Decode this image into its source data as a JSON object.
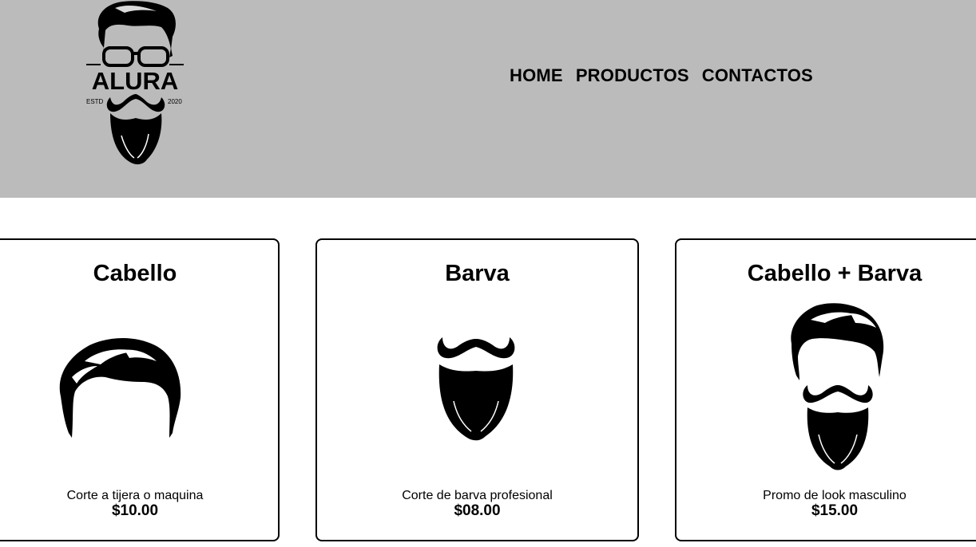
{
  "header": {
    "logo": {
      "brand": "ALURA",
      "estd_label": "ESTD",
      "year": "2020"
    },
    "nav": [
      {
        "label": "HOME"
      },
      {
        "label": "PRODUCTOS"
      },
      {
        "label": "CONTACTOS"
      }
    ]
  },
  "products": [
    {
      "title": "Cabello",
      "icon": "hair-icon",
      "description": "Corte a tijera o maquina",
      "price": "$10.00"
    },
    {
      "title": "Barva",
      "icon": "beard-icon",
      "description": "Corte de barva profesional",
      "price": "$08.00"
    },
    {
      "title": "Cabello + Barva",
      "icon": "hair-and-beard-icon",
      "description": "Promo de look masculino",
      "price": "$15.00"
    }
  ],
  "colors": {
    "header_bg": "#bbbbbb",
    "text": "#000000",
    "card_border": "#000000"
  }
}
